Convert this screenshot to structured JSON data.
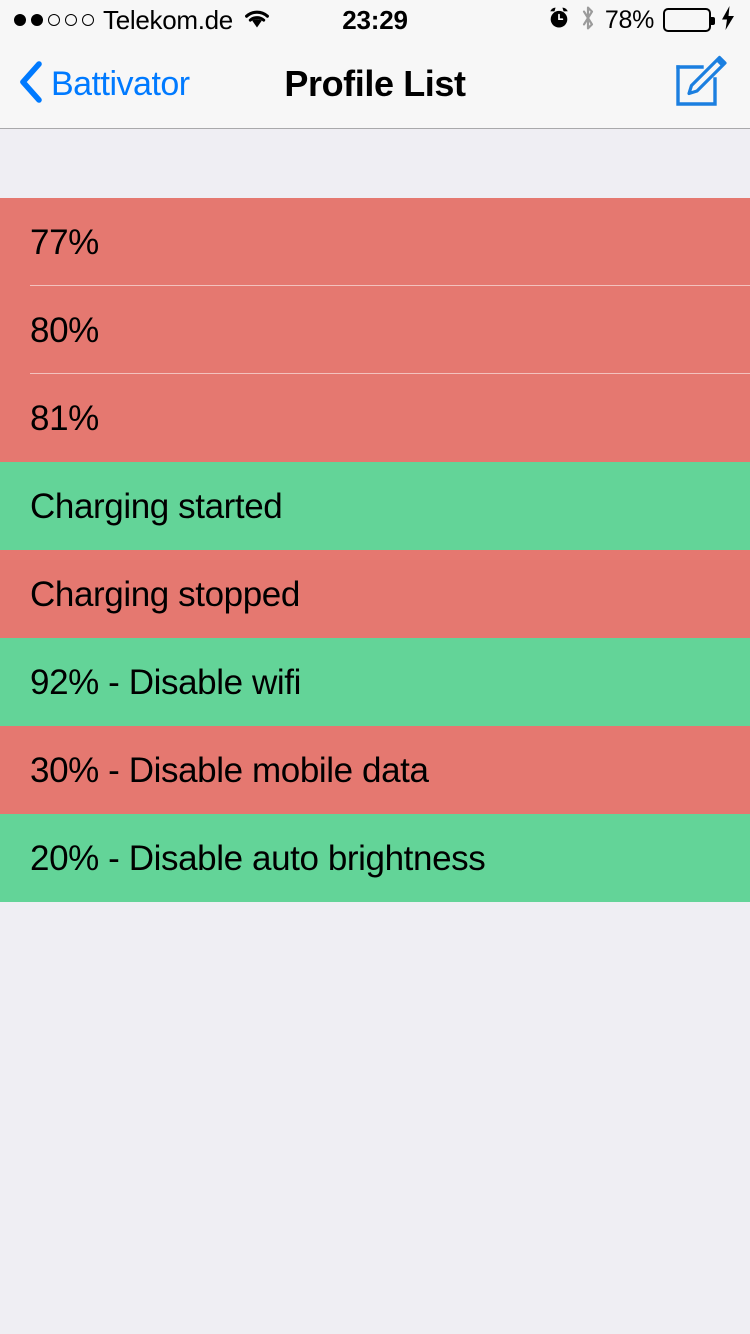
{
  "status_bar": {
    "signal_dots_filled": 2,
    "signal_dots_total": 5,
    "carrier": "Telekom.de",
    "wifi_icon": "wifi-icon",
    "time": "23:29",
    "alarm_icon": "alarm-clock-icon",
    "bluetooth_icon": "bluetooth-icon",
    "battery_percent": "78%",
    "battery_level": 78,
    "battery_fill_color": "#4CD964",
    "charging_icon": "lightning-bolt-icon"
  },
  "nav_bar": {
    "back_icon": "chevron-left-icon",
    "back_label": "Battivator",
    "title": "Profile List",
    "compose_icon": "compose-icon",
    "accent_color": "#007AFF",
    "background_color": "#F7F7F7"
  },
  "colors": {
    "page_background": "#EFEEF3",
    "row_red": "#E57870",
    "row_green": "#63D498",
    "separator": "rgba(255,255,255,0.55)"
  },
  "profiles": [
    {
      "label": "77%",
      "state": "red"
    },
    {
      "label": "80%",
      "state": "red"
    },
    {
      "label": "81%",
      "state": "red"
    },
    {
      "label": "Charging started",
      "state": "green"
    },
    {
      "label": "Charging stopped",
      "state": "red"
    },
    {
      "label": "92% - Disable wifi",
      "state": "green"
    },
    {
      "label": "30% - Disable mobile data",
      "state": "red"
    },
    {
      "label": "20% - Disable auto brightness",
      "state": "green"
    }
  ]
}
